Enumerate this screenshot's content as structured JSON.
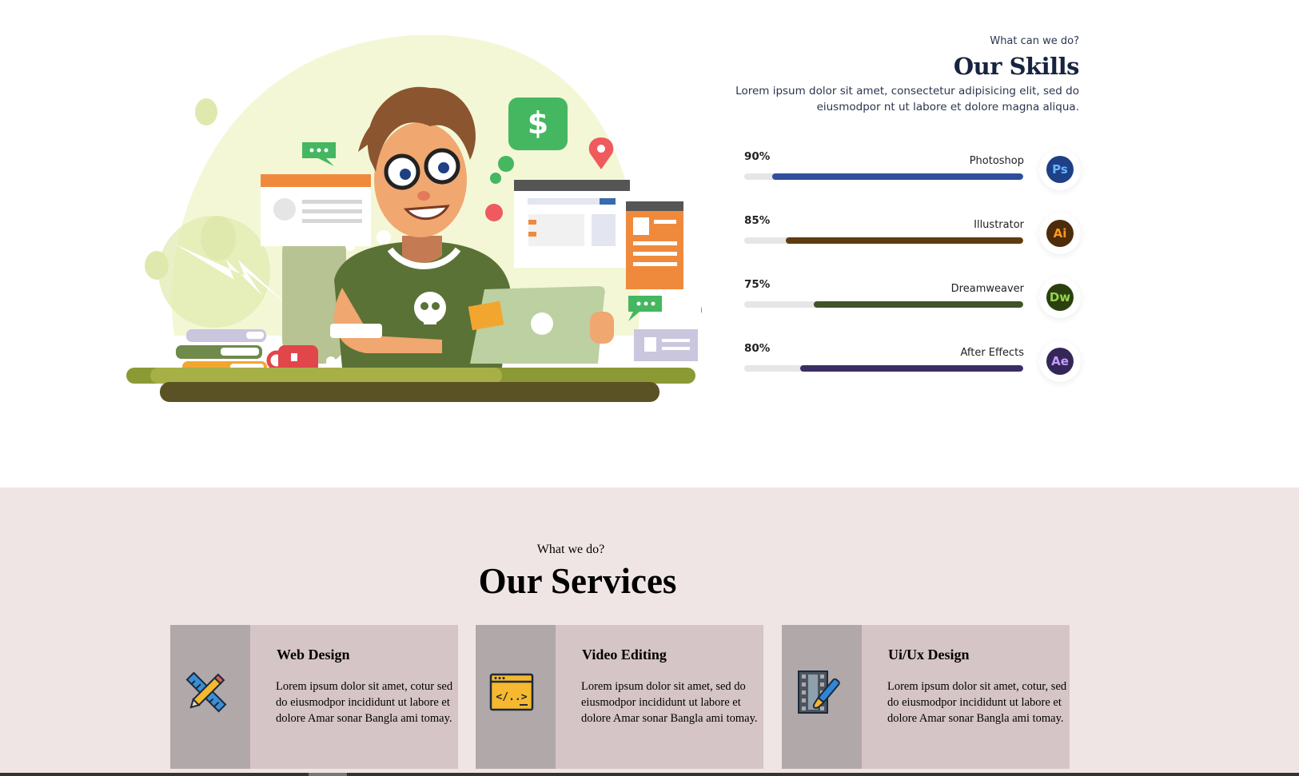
{
  "skills": {
    "kicker": "What can we do?",
    "title": "Our Skills",
    "description": "Lorem ipsum dolor sit amet, consectetur adipisicing elit, sed do eiusmodpor nt ut labore et dolore magna aliqua.",
    "items": [
      {
        "percent_label": "90%",
        "value": 0.9,
        "name": "Photoshop",
        "icon": "photoshop-icon",
        "icon_text": "Ps",
        "color": "#2f4f9c",
        "icon_bg": "#1f3f86",
        "icon_fg": "#66b6ff"
      },
      {
        "percent_label": "85%",
        "value": 0.85,
        "name": "Illustrator",
        "icon": "illustrator-icon",
        "icon_text": "Ai",
        "color": "#5e3c12",
        "icon_bg": "#4d2c0b",
        "icon_fg": "#ff9a1f"
      },
      {
        "percent_label": "75%",
        "value": 0.75,
        "name": "Dreamweaver",
        "icon": "dreamweaver-icon",
        "icon_text": "Dw",
        "color": "#3f5428",
        "icon_bg": "#2a4010",
        "icon_fg": "#95d44a"
      },
      {
        "percent_label": "80%",
        "value": 0.8,
        "name": "After Effects",
        "icon": "after-effects-icon",
        "icon_text": "Ae",
        "color": "#3a2e63",
        "icon_bg": "#352658",
        "icon_fg": "#c49cff"
      }
    ]
  },
  "illustration": {
    "name": "developer-at-desk-illustration",
    "price_symbol": "$"
  },
  "services": {
    "kicker": "What we do?",
    "title": "Our Services",
    "items": [
      {
        "title": "Web Design",
        "description": "Lorem ipsum dolor sit amet, cotur sed do eiusmodpor incididunt ut labore et dolore Amar sonar Bangla ami tomay.",
        "icon": "ruler-pencil-icon"
      },
      {
        "title": "Video Editing",
        "description": "Lorem ipsum dolor sit amet, sed do eiusmodpor incididunt ut labore et dolore Amar sonar Bangla ami tomay.",
        "icon": "code-window-icon"
      },
      {
        "title": "Ui/Ux Design",
        "description": "Lorem ipsum dolor sit amet, cotur, sed do eiusmodpor incididunt ut labore et dolore Amar sonar Bangla ami tomay.",
        "icon": "film-brush-icon"
      }
    ]
  },
  "colors": {
    "services_bg": "#f0e5e5",
    "card_bg": "#d6c5c6",
    "card_icon_bg": "#b0a8a9",
    "heading_navy": "#17243f"
  }
}
